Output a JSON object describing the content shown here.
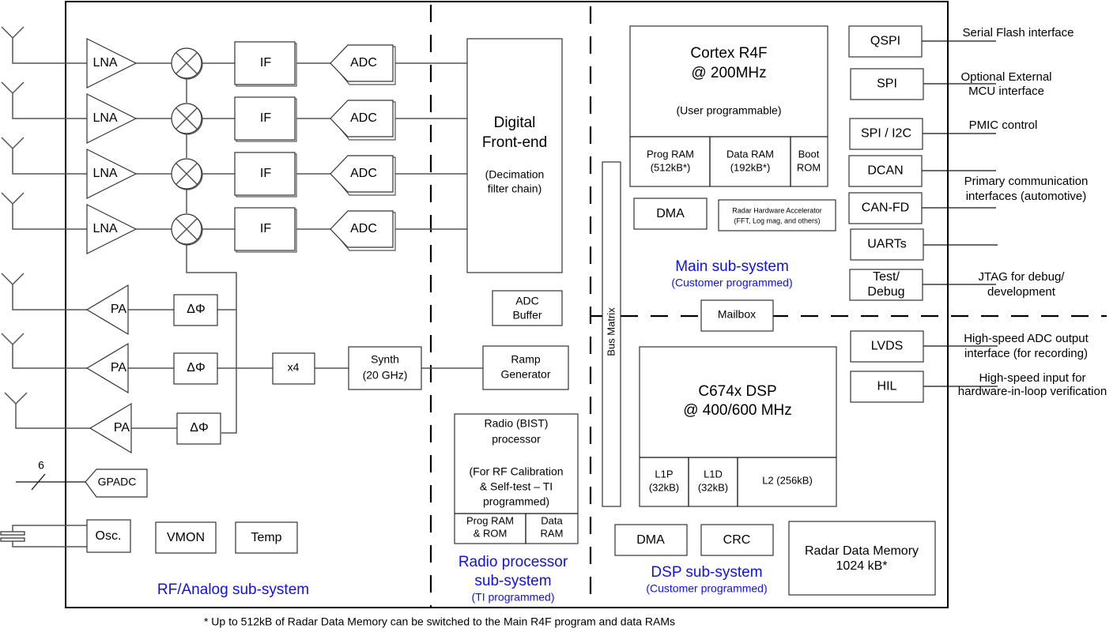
{
  "diagram": {
    "rf": {
      "receive_chain": {
        "lna": "LNA",
        "if": "IF",
        "adc": "ADC",
        "count": 4
      },
      "transmit_chain": {
        "pa": "PA",
        "phase_shifter": "ΔΦ",
        "count": 3
      },
      "multiplier": "x4",
      "synth": {
        "line1": "Synth",
        "line2": "(20 GHz)"
      },
      "gpadc": "GPADC",
      "gpadc_bus_width": "6",
      "osc": "Osc.",
      "vmon": "VMON",
      "temp": "Temp",
      "title": "RF/Analog sub-system"
    },
    "radio": {
      "dfe": {
        "line1": "Digital",
        "line2": "Front-end",
        "sub1": "(Decimation",
        "sub2": "filter chain)"
      },
      "adc_buffer": {
        "line1": "ADC",
        "line2": "Buffer"
      },
      "ramp": {
        "line1": "Ramp",
        "line2": "Generator"
      },
      "bist": {
        "line1": "Radio (BIST)",
        "line2": "processor",
        "line3": "(For RF Calibration",
        "line4": "& Self-test  – TI",
        "line5": "programmed)",
        "prog_ram1": "Prog RAM",
        "prog_ram2": "& ROM",
        "data_ram1": "Data",
        "data_ram2": "RAM"
      },
      "title1": "Radio processor",
      "title2": "sub-system",
      "subtitle": "(TI programmed)"
    },
    "bus_matrix": "Bus Matrix",
    "main": {
      "cpu": {
        "line1": "Cortex R4F",
        "line2": "@ 200MHz",
        "line3": "(User programmable)"
      },
      "prog_ram": {
        "line1": "Prog RAM",
        "line2": "(512kB*)"
      },
      "data_ram": {
        "line1": "Data RAM",
        "line2": "(192kB*)"
      },
      "boot_rom": {
        "line1": "Boot",
        "line2": "ROM"
      },
      "dma": "DMA",
      "hwa": {
        "line1": "Radar Hardware Accelerator",
        "line2": "(FFT, Log mag, and others)"
      },
      "title": "Main sub-system",
      "subtitle": "(Customer programmed)"
    },
    "mailbox": "Mailbox",
    "dsp": {
      "cpu": {
        "line1": "C674x DSP",
        "line2": "@ 400/600 MHz"
      },
      "l1p": {
        "line1": "L1P",
        "line2": "(32kB)"
      },
      "l1d": {
        "line1": "L1D",
        "line2": "(32kB)"
      },
      "l2": "L2 (256kB)",
      "dma": "DMA",
      "crc": "CRC",
      "radar_mem": {
        "line1": "Radar Data Memory",
        "line2": "1024 kB*"
      },
      "title": "DSP sub-system",
      "subtitle": "(Customer programmed)"
    },
    "peripherals": [
      {
        "label": "QSPI"
      },
      {
        "label": "SPI"
      },
      {
        "label": "SPI / I2C"
      },
      {
        "label": "DCAN"
      },
      {
        "label": "CAN-FD"
      },
      {
        "label": "UARTs"
      },
      {
        "label1": "Test/",
        "label2": "Debug"
      },
      {
        "label": "LVDS"
      },
      {
        "label": "HIL"
      }
    ],
    "external_labels": {
      "qspi": "Serial Flash interface",
      "spi1": "Optional External",
      "spi2": "MCU interface",
      "pmic": "PMIC control",
      "can1": "Primary communication",
      "can2": "interfaces (automotive)",
      "jtag1": "JTAG for debug/",
      "jtag2": "development",
      "lvds1": "High-speed ADC output",
      "lvds2": "interface (for recording)",
      "hil1": "High-speed input for",
      "hil2": "hardware-in-loop verification"
    },
    "footnote": "* Up to 512kB of Radar Data Memory can be switched to the Main R4F program and data RAMs",
    "colors": {
      "subsystem_title": "#1010e8",
      "line": "#555555",
      "frame": "#000000"
    }
  }
}
